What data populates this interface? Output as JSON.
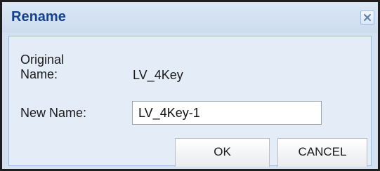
{
  "dialog": {
    "title": "Rename",
    "close_icon": "close-icon"
  },
  "form": {
    "original_name_label": "Original Name:",
    "original_name_value": "LV_4Key",
    "new_name_label": "New Name:",
    "new_name_value": "LV_4Key-1"
  },
  "buttons": {
    "ok_label": "OK",
    "cancel_label": "CANCEL"
  },
  "colors": {
    "title_text": "#15428b",
    "dialog_background": "#d3e1f1",
    "panel_background": "#e3ecf7",
    "panel_border": "#99bbe8"
  }
}
